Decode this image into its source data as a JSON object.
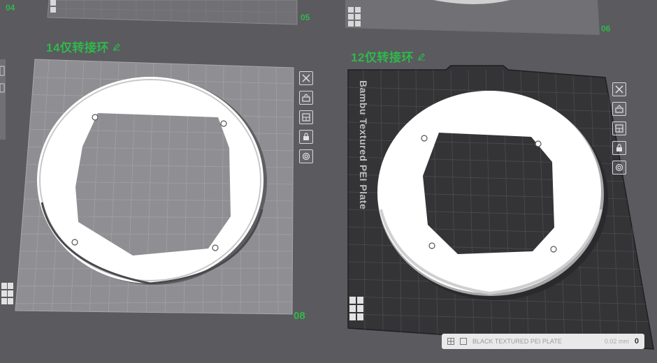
{
  "plates": [
    {
      "label": "14仅转接环",
      "number": "08",
      "type": "smooth"
    },
    {
      "label": "12仅转接环",
      "number": "",
      "type": "textured",
      "bed_text": "Bambu Textured PEI Plate"
    }
  ],
  "background_plates": [
    {
      "number": "04"
    },
    {
      "number": "05"
    },
    {
      "number": "06"
    }
  ],
  "plate_toolbar": [
    {
      "name": "delete-plate",
      "icon": "close-icon"
    },
    {
      "name": "auto-orient",
      "icon": "orient-icon"
    },
    {
      "name": "arrange",
      "icon": "arrange-icon"
    },
    {
      "name": "lock-plate",
      "icon": "lock-icon"
    },
    {
      "name": "plate-settings",
      "icon": "gear-icon"
    }
  ],
  "status_bar": {
    "text": "BLACK TEXTURED PEI PLATE",
    "sub": "0.02 mm",
    "count": "0"
  },
  "colors": {
    "accent": "#2fb84a",
    "background": "#5a5a5f",
    "smooth_plate": "#8f8f93",
    "textured_plate": "#343437",
    "ring": "#ffffff"
  }
}
